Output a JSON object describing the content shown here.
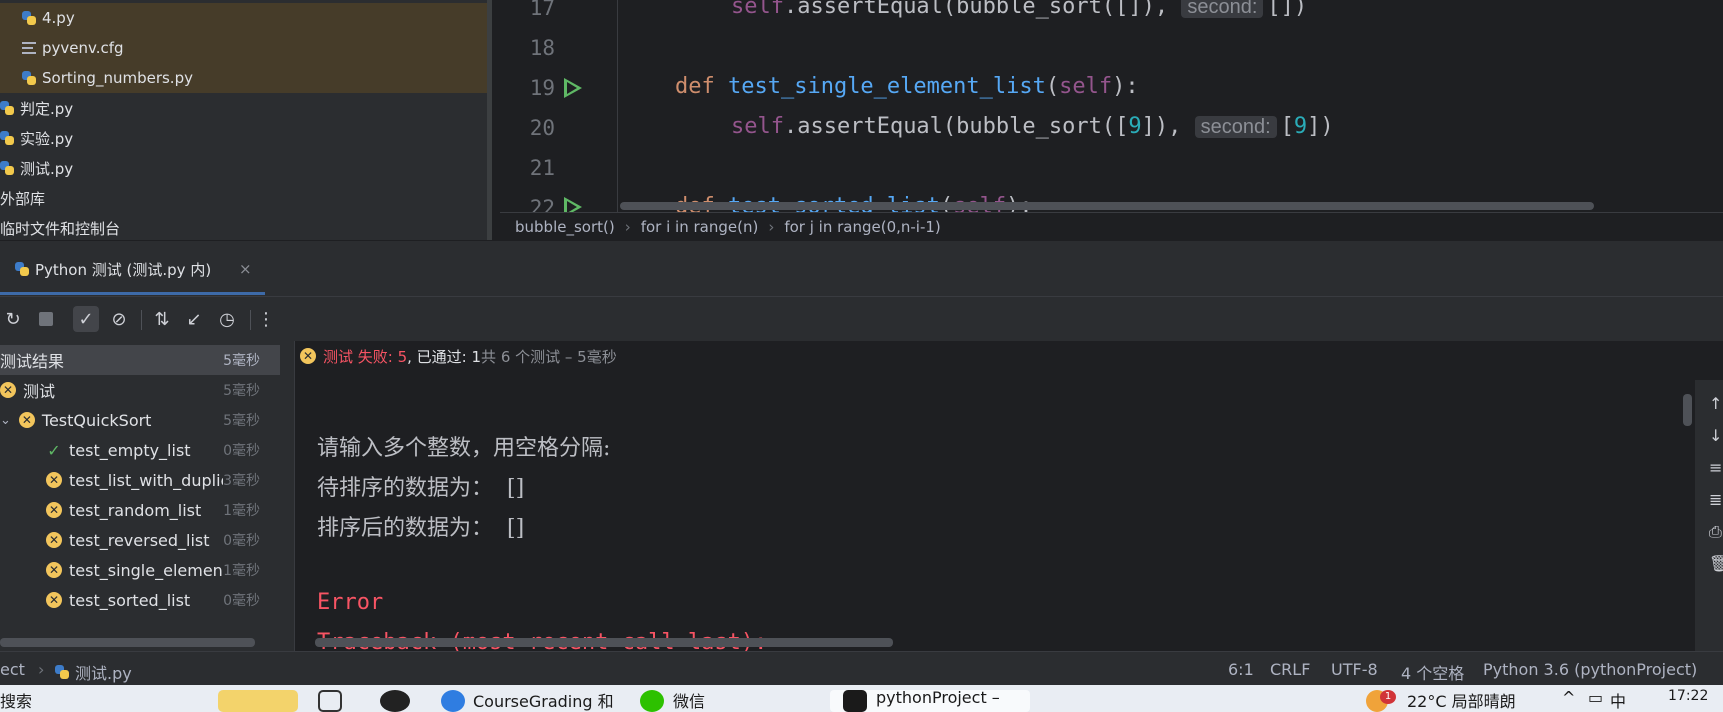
{
  "project_tree": {
    "items": [
      {
        "label": "4.py",
        "icon": "python-file-icon"
      },
      {
        "label": "pyvenv.cfg",
        "icon": "config-file-icon"
      },
      {
        "label": "Sorting_numbers.py",
        "icon": "python-file-icon"
      },
      {
        "label": "判定.py",
        "icon": "python-file-icon"
      },
      {
        "label": "实验.py",
        "icon": "python-file-icon"
      },
      {
        "label": "测试.py",
        "icon": "python-file-icon"
      },
      {
        "label": "外部库",
        "icon": ""
      },
      {
        "label": "临时文件和控制台",
        "icon": ""
      }
    ]
  },
  "editor": {
    "line_numbers": [
      "17",
      "18",
      "19",
      "20",
      "21",
      "22"
    ],
    "line17": {
      "self": "self",
      "call": ".assertEqual(bubble_sort([]), ",
      "hint": "second:",
      "rest": "[])"
    },
    "line19": {
      "def": "def ",
      "fn": "test_single_element_list",
      "open": "(",
      "self": "self",
      "close": "):"
    },
    "line20": {
      "self": "self",
      "call": ".assertEqual(bubble_sort([",
      "num": "9",
      "mid": "]), ",
      "hint": "second:",
      "open": "[",
      "num2": "9",
      "close": "])"
    },
    "line22": {
      "def": "def ",
      "fn": "test_sorted_list",
      "open": "(",
      "self": "self",
      "close": "):"
    }
  },
  "breadcrumbs": [
    "bubble_sort()",
    "for i in range(n)",
    "for j in range(0,n-i-1)"
  ],
  "run_tab": {
    "title": "Python 测试 (测试.py 内)",
    "close": "×"
  },
  "test_tree": {
    "root": {
      "label": "测试结果",
      "time": "5毫秒"
    },
    "suite": {
      "label": "测试",
      "time": "5毫秒"
    },
    "class": {
      "label": "TestQuickSort",
      "time": "5毫秒"
    },
    "tests": [
      {
        "label": "test_empty_list",
        "time": "0毫秒",
        "status": "passed"
      },
      {
        "label": "test_list_with_duplica",
        "time": "3毫秒",
        "status": "failed"
      },
      {
        "label": "test_random_list",
        "time": "1毫秒",
        "status": "failed"
      },
      {
        "label": "test_reversed_list",
        "time": "0毫秒",
        "status": "failed"
      },
      {
        "label": "test_single_element_li",
        "time": "1毫秒",
        "status": "failed"
      },
      {
        "label": "test_sorted_list",
        "time": "0毫秒",
        "status": "failed"
      }
    ]
  },
  "summary": {
    "failed": "测试 失败: 5",
    "passed": ", 已通过: 1",
    "total": "共 6 个测试 – 5毫秒"
  },
  "console": {
    "lines": [
      "请输入多个整数，用空格分隔:",
      "待排序的数据为：  []",
      "排序后的数据为：  []"
    ],
    "error": "Error",
    "traceback": "Traceback (most recent call last):"
  },
  "statusbar": {
    "project": "ect",
    "file": "测试.py",
    "position": "6:1",
    "line_sep": "CRLF",
    "encoding": "UTF-8",
    "indent": "4 个空格",
    "interpreter": "Python 3.6 (pythonProject)"
  },
  "taskbar": {
    "search": "搜索",
    "app1": "CourseGrading 和",
    "app2": "微信",
    "app3": "pythonProject –",
    "badge": "1",
    "weather": "22°C  局部晴朗",
    "lang": "中",
    "time": "17:22"
  },
  "colors": {
    "fail": "#f75464",
    "pass": "#5fb865",
    "keyword": "#cf8e6d",
    "function": "#56a8f5",
    "self": "#94558d",
    "number": "#2aacb8"
  }
}
